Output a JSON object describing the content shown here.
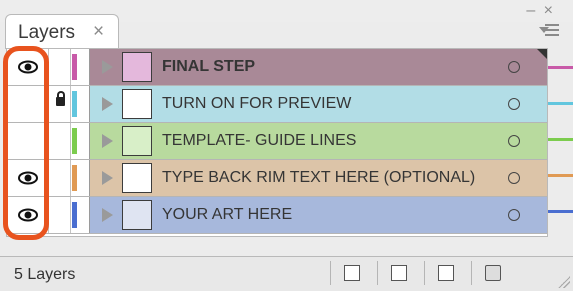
{
  "panel": {
    "tab_label": "Layers",
    "tab_close_glyph": "×",
    "window_controls": "– ×"
  },
  "layers": [
    {
      "name": "FINAL STEP",
      "visible": true,
      "locked": false,
      "color": "#c85aa8",
      "tint": "#a98997",
      "thumb_bg": "#e4b8dc",
      "bold": true
    },
    {
      "name": "TURN ON FOR PREVIEW",
      "visible": false,
      "locked": true,
      "color": "#62c6de",
      "tint": "#b2dde6",
      "thumb_bg": "#ffffff",
      "bold": false
    },
    {
      "name": "TEMPLATE- GUIDE LINES",
      "visible": false,
      "locked": false,
      "color": "#7ccc4e",
      "tint": "#b8da9e",
      "thumb_bg": "#d8efc8",
      "bold": false
    },
    {
      "name": "TYPE BACK RIM TEXT HERE (OPTIONAL)",
      "visible": true,
      "locked": false,
      "color": "#e09a54",
      "tint": "#dcc4a8",
      "thumb_bg": "#ffffff",
      "bold": false
    },
    {
      "name": "YOUR ART HERE",
      "visible": true,
      "locked": false,
      "color": "#4a6ed0",
      "tint": "#a7b8dc",
      "thumb_bg": "#dfe4f2",
      "bold": false
    }
  ],
  "footer": {
    "count": "5 Layers",
    "buttons": [
      "make-clipping-mask",
      "create-sublayer",
      "create-layer",
      "delete-layer"
    ]
  },
  "icons": {
    "eye": "eye-icon",
    "lock": "lock-icon",
    "expand": "disclosure-triangle-icon",
    "target": "target-circle-icon",
    "menu": "panel-menu-icon"
  },
  "accent": "#e8531e"
}
